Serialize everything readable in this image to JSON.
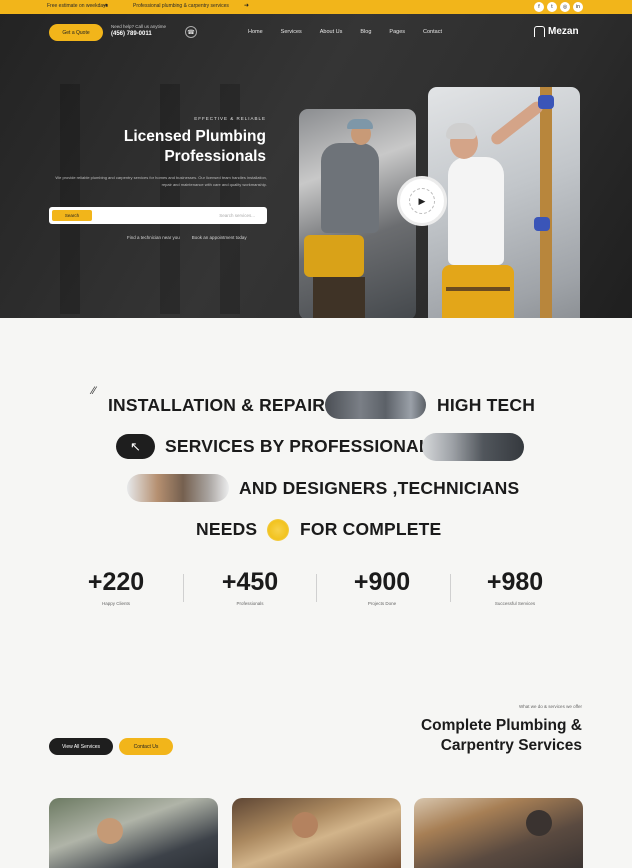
{
  "topbar": {
    "note_left": "Free estimate on weekdays",
    "note_middle": "Professional plumbing & carpentry services",
    "social_icons": [
      "facebook-icon",
      "twitter-icon",
      "instagram-icon",
      "linkedin-icon"
    ]
  },
  "nav": {
    "cta_label": "Get a Quote",
    "call_label": "Need help? Call us anytime",
    "call_number": "(456) 789-0011",
    "links": [
      "Home",
      "Services",
      "About Us",
      "Blog",
      "Pages",
      "Contact"
    ],
    "logo_text": "Mezan"
  },
  "hero": {
    "eyebrow": "EFFECTIVE & RELIABLE",
    "title": "Licensed Plumbing Professionals",
    "description": "We provide reliable plumbing and carpentry services for homes and businesses. Our licensed team handles installation, repair and maintenance with care and quality workmanship.",
    "search_button": "Search",
    "search_placeholder": "Search services...",
    "link_1": "Find a technician near you",
    "link_2": "Book an appointment today"
  },
  "services_words": {
    "line1_a": "INSTALLATION & REPAIR",
    "line1_b": "HIGH TECH",
    "line2_a": "SERVICES BY PROFESSIONAL",
    "line3_a": "AND DESIGNERS ,TECHNICIANS",
    "line4_a": "NEEDS",
    "line4_b": "FOR COMPLETE",
    "arrow_glyph": "↖"
  },
  "stats": [
    {
      "value": "+220",
      "label": "Happy Clients"
    },
    {
      "value": "+450",
      "label": "Professionals"
    },
    {
      "value": "+900",
      "label": "Projects Done"
    },
    {
      "value": "+980",
      "label": "Successful Services"
    }
  ],
  "section2": {
    "eyebrow": "What we do & services we offer",
    "title": "Complete Plumbing & Carpentry Services",
    "tab_dark": "View All Services",
    "tab_yellow": "Contact Us"
  },
  "colors": {
    "accent": "#f2b51a",
    "dark": "#1e1e1e"
  }
}
